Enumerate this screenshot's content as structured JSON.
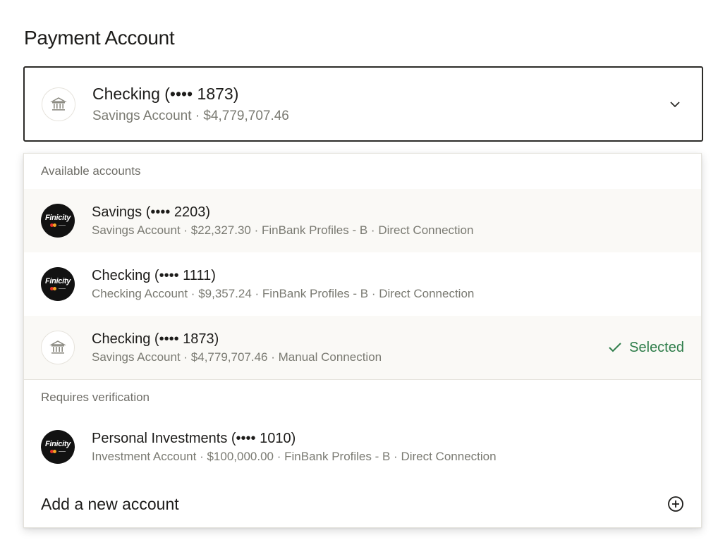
{
  "page": {
    "title": "Payment Account"
  },
  "selected_account": {
    "name": "Checking (•••• 1873)",
    "detail": "Savings Account · $4,779,707.46",
    "icon": "bank-icon"
  },
  "dropdown": {
    "available_label": "Available accounts",
    "available": [
      {
        "name": "Savings (•••• 2203)",
        "detail": "Savings Account · $22,327.30 · FinBank Profiles - B · Direct Connection",
        "icon": "finicity-logo",
        "logo_text": "Finicity"
      },
      {
        "name": "Checking (•••• 1111)",
        "detail": "Checking Account · $9,357.24 · FinBank Profiles - B · Direct Connection",
        "icon": "finicity-logo",
        "logo_text": "Finicity"
      },
      {
        "name": "Checking (•••• 1873)",
        "detail": "Savings Account · $4,779,707.46 · Manual Connection",
        "icon": "bank-icon",
        "status": "Selected"
      }
    ],
    "verification_label": "Requires verification",
    "verification": [
      {
        "name": "Personal Investments (•••• 1010)",
        "detail": "Investment Account · $100,000.00 · FinBank Profiles - B · Direct Connection",
        "icon": "finicity-logo",
        "logo_text": "Finicity"
      }
    ],
    "add_label": "Add a new account"
  },
  "colors": {
    "selected": "#2e7d4a",
    "border": "#2c2b28",
    "muted": "#7a7a72"
  }
}
